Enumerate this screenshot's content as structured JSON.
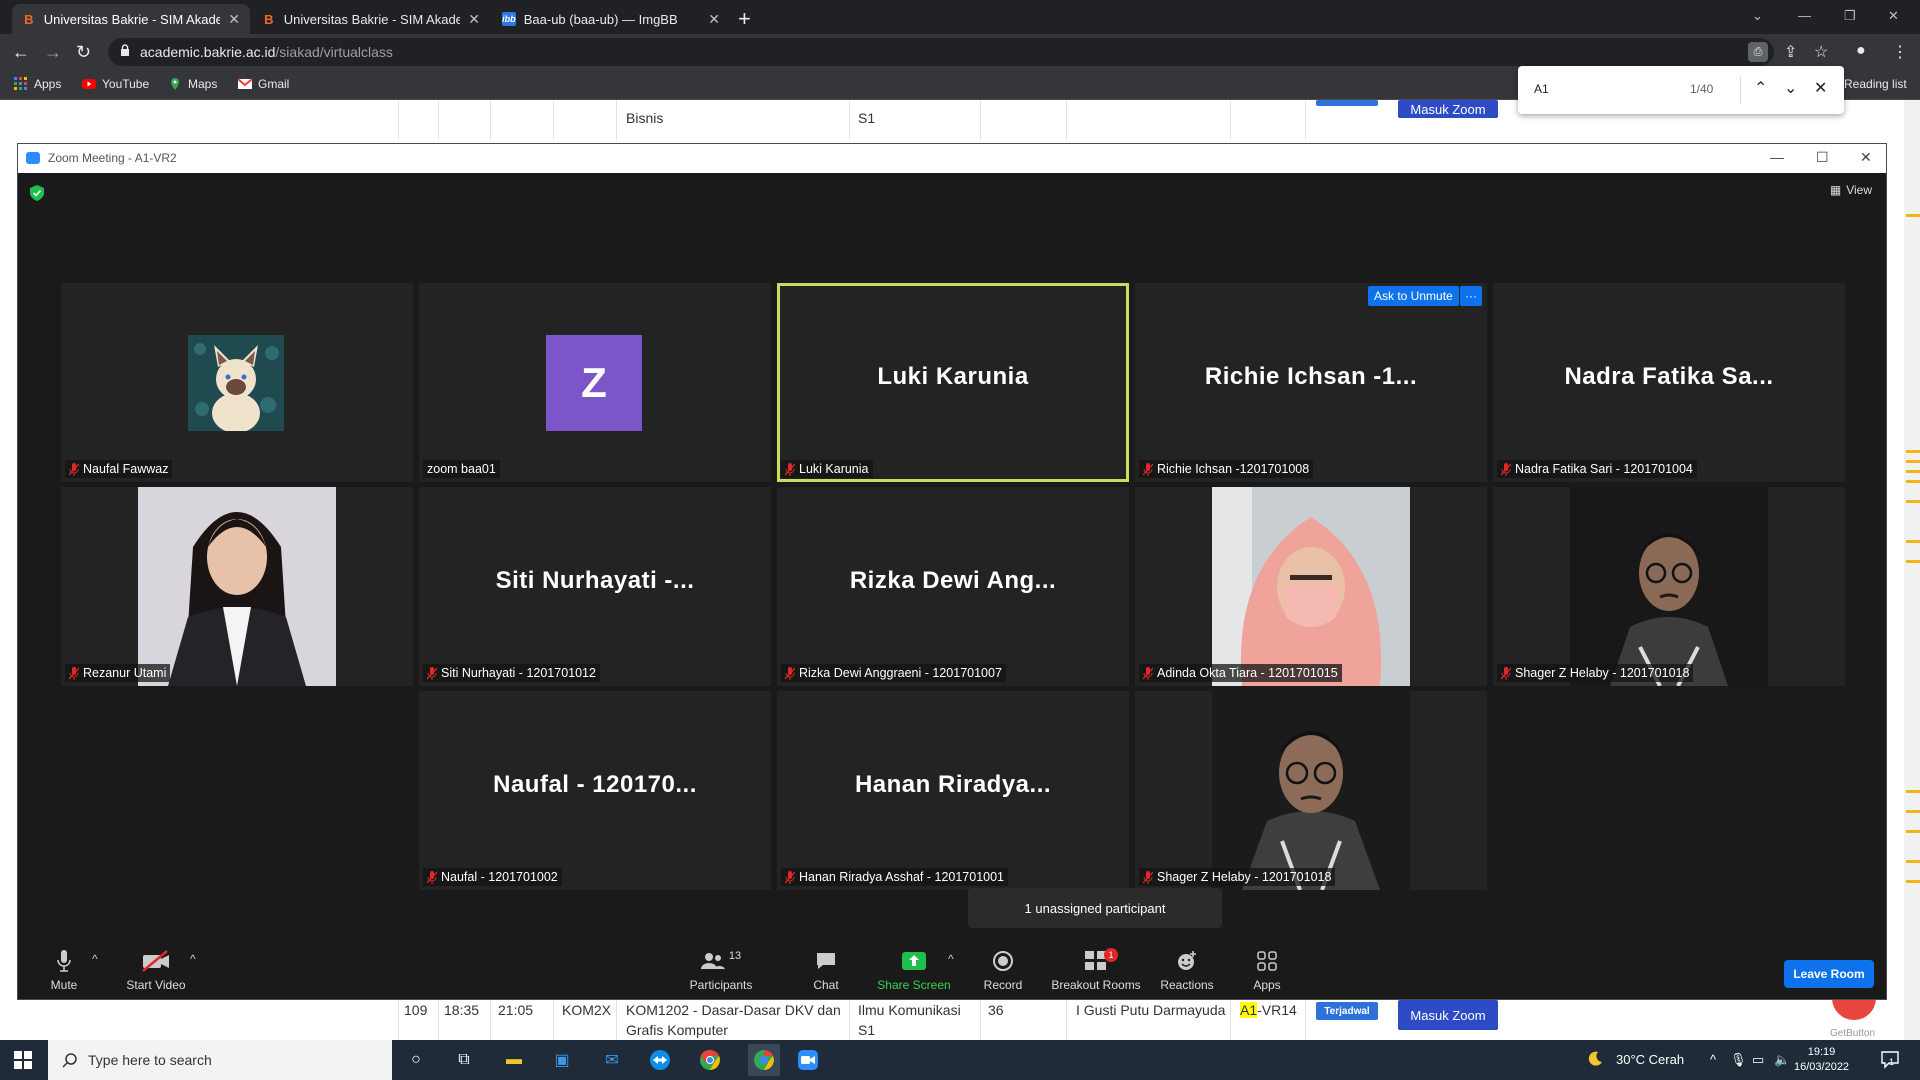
{
  "browser": {
    "tabs": [
      {
        "label": "Universitas Bakrie - SIM Akadem",
        "icon": "B",
        "active": true
      },
      {
        "label": "Universitas Bakrie - SIM Akadem",
        "icon": "B",
        "active": false
      },
      {
        "label": "Baa-ub (baa-ub) — ImgBB",
        "icon": "ibb",
        "active": false
      }
    ],
    "url_host": "academic.bakrie.ac.id",
    "url_path": "/siakad/virtualclass",
    "bookmarks": [
      "Apps",
      "YouTube",
      "Maps",
      "Gmail"
    ],
    "reading_list": "Reading list"
  },
  "findbar": {
    "query": "A1",
    "count": "1/40"
  },
  "background_page": {
    "top_row": {
      "prodi": "Bisnis",
      "level": "S1",
      "button": "Masuk Zoom"
    },
    "bottom_row": {
      "no": "109",
      "start": "18:35",
      "end": "21:05",
      "kelas": "KOM2X",
      "matkul": "KOM1202 - Dasar-Dasar DKV dan Grafis Komputer",
      "prodi": "Ilmu Komunikasi S1",
      "peserta": "36",
      "dosen": "I Gusti Putu Darmayuda",
      "room_hl": "A1",
      "room_rest": "-VR14",
      "status": "Terjadwal",
      "button": "Masuk Zoom",
      "get_button": "GetButton"
    }
  },
  "zoom": {
    "title": "Zoom Meeting - A1-VR2",
    "view_label": "View",
    "ask_unmute": "Ask to Unmute",
    "more": "···",
    "participants": [
      {
        "tag": "Naufal Fawwaz",
        "big": "",
        "kind": "cat"
      },
      {
        "tag": "zoom baa01",
        "big": "",
        "kind": "avatar",
        "letter": "Z"
      },
      {
        "tag": "Luki Karunia",
        "big": "Luki Karunia",
        "kind": "name",
        "active": true
      },
      {
        "tag": "Richie Ichsan -1201701008",
        "big": "Richie Ichsan -1...",
        "kind": "name"
      },
      {
        "tag": "Nadra Fatika Sari - 1201701004",
        "big": "Nadra Fatika Sa...",
        "kind": "name"
      },
      {
        "tag": "Rezanur Utami",
        "big": "",
        "kind": "photo-woman"
      },
      {
        "tag": "Siti Nurhayati - 1201701012",
        "big": "Siti Nurhayati -...",
        "kind": "name"
      },
      {
        "tag": "Rizka Dewi Anggraeni - 1201701007",
        "big": "Rizka Dewi Ang...",
        "kind": "name"
      },
      {
        "tag": "Adinda Okta Tiara - 1201701015",
        "big": "",
        "kind": "photo-hijab"
      },
      {
        "tag": "Shager Z Helaby - 1201701018",
        "big": "",
        "kind": "photo-man"
      },
      {
        "tag": "Naufal - 1201701002",
        "big": "Naufal - 120170...",
        "kind": "name"
      },
      {
        "tag": "Hanan Riradya Asshaf - 1201701001",
        "big": "Hanan Riradya...",
        "kind": "name"
      },
      {
        "tag": "Shager Z Helaby - 1201701018",
        "big": "",
        "kind": "photo-man"
      }
    ],
    "tooltip": "1 unassigned participant",
    "toolbar": {
      "mute": "Mute",
      "start_video": "Start Video",
      "participants": "Participants",
      "participants_count": "13",
      "chat": "Chat",
      "share_screen": "Share Screen",
      "record": "Record",
      "breakout": "Breakout Rooms",
      "breakout_badge": "1",
      "reactions": "Reactions",
      "apps": "Apps",
      "leave": "Leave Room"
    }
  },
  "taskbar": {
    "search_placeholder": "Type here to search",
    "weather": "30°C  Cerah",
    "time": "19:19",
    "date": "16/03/2022",
    "notif_count": "1"
  },
  "colors": {
    "zoom_blue": "#0e72ed",
    "active_speaker": "#c9dc5b",
    "share_green": "#39d353",
    "avatar_purple": "#7c55c8"
  }
}
